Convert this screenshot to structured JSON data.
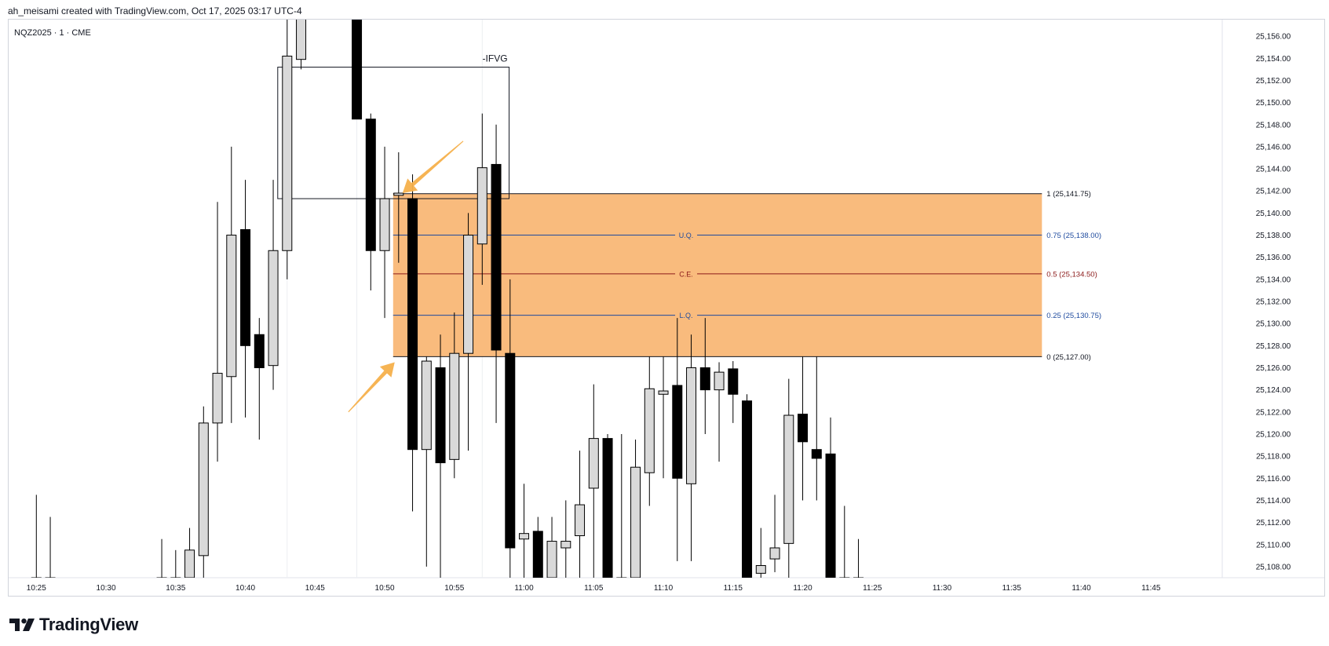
{
  "header": {
    "text": "ah_meisami created with TradingView.com, Oct 17, 2025 03:17 UTC-4"
  },
  "symbol": {
    "text": "NQZ2025 · 1 · CME"
  },
  "footer": {
    "brand": "TradingView"
  },
  "colors": {
    "up_body": "#d9d9d9",
    "down_body": "#000000",
    "wick": "#000000",
    "zone_fill": "#f9bb7d",
    "zone_line": "#131722",
    "level_blue": "#1e4a9e",
    "level_red": "#8b1a1a",
    "arrow": "#f5b04b"
  },
  "chart_data": {
    "type": "candlestick",
    "symbol": "NQZ2025",
    "interval": "1",
    "exchange": "CME",
    "ylim": [
      25107,
      25157.5
    ],
    "y_ticks": [
      "25,108.00",
      "25,110.00",
      "25,112.00",
      "25,114.00",
      "25,116.00",
      "25,118.00",
      "25,120.00",
      "25,122.00",
      "25,124.00",
      "25,126.00",
      "25,128.00",
      "25,130.00",
      "25,132.00",
      "25,134.00",
      "25,136.00",
      "25,138.00",
      "25,140.00",
      "25,142.00",
      "25,144.00",
      "25,146.00",
      "25,148.00",
      "25,150.00",
      "25,152.00",
      "25,154.00",
      "25,156.00"
    ],
    "x_ticks": [
      "10:25",
      "10:30",
      "10:35",
      "10:40",
      "10:45",
      "10:50",
      "10:55",
      "11:00",
      "11:05",
      "11:10",
      "11:15",
      "11:20",
      "11:25",
      "11:30",
      "11:35",
      "11:40",
      "11:45"
    ],
    "candles": [
      {
        "t": "10:25",
        "o": 25107,
        "h": 25114.5,
        "l": 25107,
        "c": 25107
      },
      {
        "t": "10:26",
        "o": 25107,
        "h": 25112.5,
        "l": 25107,
        "c": 25107
      },
      {
        "t": "10:34",
        "o": 25107,
        "h": 25110.5,
        "l": 25107,
        "c": 25107
      },
      {
        "t": "10:35",
        "o": 25107,
        "h": 25109.5,
        "l": 25107,
        "c": 25107
      },
      {
        "t": "10:36",
        "o": 25107,
        "h": 25111.5,
        "l": 25107,
        "c": 25109.5
      },
      {
        "t": "10:37",
        "o": 25109,
        "h": 25122.5,
        "l": 25107,
        "c": 25121
      },
      {
        "t": "10:38",
        "o": 25121,
        "h": 25141,
        "l": 25117.5,
        "c": 25125.5
      },
      {
        "t": "10:39",
        "o": 25125.2,
        "h": 25146,
        "l": 25121,
        "c": 25138
      },
      {
        "t": "10:40",
        "o": 25138.5,
        "h": 25143,
        "l": 25121.5,
        "c": 25128
      },
      {
        "t": "10:41",
        "o": 25129,
        "h": 25130.5,
        "l": 25119.5,
        "c": 25126
      },
      {
        "t": "10:42",
        "o": 25126.2,
        "h": 25143,
        "l": 25124,
        "c": 25136.6
      },
      {
        "t": "10:43",
        "o": 25136.6,
        "h": 25158,
        "l": 25134,
        "c": 25154.2
      },
      {
        "t": "10:44",
        "o": 25153.9,
        "h": 25158,
        "l": 25153,
        "c": 25158
      },
      {
        "t": "10:48",
        "o": 25158,
        "h": 25158,
        "l": 25148.5,
        "c": 25148.5
      },
      {
        "t": "10:49",
        "o": 25148.5,
        "h": 25149,
        "l": 25133,
        "c": 25136.6
      },
      {
        "t": "10:50",
        "o": 25136.6,
        "h": 25146,
        "l": 25130.5,
        "c": 25141.3
      },
      {
        "t": "10:51",
        "o": 25141.6,
        "h": 25145.5,
        "l": 25135.5,
        "c": 25141.8
      },
      {
        "t": "10:52",
        "o": 25141.3,
        "h": 25143.5,
        "l": 25113,
        "c": 25118.6
      },
      {
        "t": "10:53",
        "o": 25118.6,
        "h": 25127,
        "l": 25108,
        "c": 25126.6
      },
      {
        "t": "10:54",
        "o": 25126,
        "h": 25129,
        "l": 25107,
        "c": 25117.4
      },
      {
        "t": "10:55",
        "o": 25117.7,
        "h": 25131,
        "l": 25116,
        "c": 25127.3
      },
      {
        "t": "10:56",
        "o": 25127.3,
        "h": 25140,
        "l": 25118.5,
        "c": 25138
      },
      {
        "t": "10:57",
        "o": 25137.2,
        "h": 25149,
        "l": 25133.5,
        "c": 25144.1
      },
      {
        "t": "10:58",
        "o": 25144.4,
        "h": 25148,
        "l": 25121,
        "c": 25127.6
      },
      {
        "t": "10:59",
        "o": 25127.3,
        "h": 25134,
        "l": 25107,
        "c": 25109.7
      },
      {
        "t": "11:00",
        "o": 25110.5,
        "h": 25115.5,
        "l": 25107,
        "c": 25111
      },
      {
        "t": "11:01",
        "o": 25111.2,
        "h": 25112.5,
        "l": 25107,
        "c": 25107
      },
      {
        "t": "11:02",
        "o": 25107,
        "h": 25112.5,
        "l": 25107,
        "c": 25110.3
      },
      {
        "t": "11:03",
        "o": 25109.7,
        "h": 25114,
        "l": 25107,
        "c": 25110.3
      },
      {
        "t": "11:04",
        "o": 25110.8,
        "h": 25118.5,
        "l": 25107,
        "c": 25113.6
      },
      {
        "t": "11:05",
        "o": 25115.1,
        "h": 25124.5,
        "l": 25107,
        "c": 25119.6
      },
      {
        "t": "11:06",
        "o": 25119.6,
        "h": 25120,
        "l": 25107,
        "c": 25107
      },
      {
        "t": "11:07",
        "o": 25107,
        "h": 25120,
        "l": 25107,
        "c": 25107
      },
      {
        "t": "11:08",
        "o": 25107,
        "h": 25119.5,
        "l": 25107,
        "c": 25117
      },
      {
        "t": "11:09",
        "o": 25116.5,
        "h": 25127,
        "l": 25113.5,
        "c": 25124.1
      },
      {
        "t": "11:10",
        "o": 25123.6,
        "h": 25127,
        "l": 25116,
        "c": 25123.9
      },
      {
        "t": "11:11",
        "o": 25124.4,
        "h": 25130.5,
        "l": 25108.5,
        "c": 25116
      },
      {
        "t": "11:12",
        "o": 25115.5,
        "h": 25129,
        "l": 25108.5,
        "c": 25126
      },
      {
        "t": "11:13",
        "o": 25126,
        "h": 25130.5,
        "l": 25120,
        "c": 25124
      },
      {
        "t": "11:14",
        "o": 25124,
        "h": 25126.5,
        "l": 25117.5,
        "c": 25125.6
      },
      {
        "t": "11:15",
        "o": 25125.9,
        "h": 25126.6,
        "l": 25121,
        "c": 25123.6
      },
      {
        "t": "11:16",
        "o": 25123,
        "h": 25123.6,
        "l": 25107,
        "c": 25107
      },
      {
        "t": "11:17",
        "o": 25107.4,
        "h": 25111.5,
        "l": 25107,
        "c": 25108.1
      },
      {
        "t": "11:18",
        "o": 25108.7,
        "h": 25114.5,
        "l": 25107.5,
        "c": 25109.7
      },
      {
        "t": "11:19",
        "o": 25110.1,
        "h": 25125,
        "l": 25107,
        "c": 25121.7
      },
      {
        "t": "11:20",
        "o": 25121.8,
        "h": 25127,
        "l": 25114,
        "c": 25119.3
      },
      {
        "t": "11:21",
        "o": 25118.6,
        "h": 25127,
        "l": 25114,
        "c": 25117.8
      },
      {
        "t": "11:22",
        "o": 25118.2,
        "h": 25121.5,
        "l": 25107,
        "c": 25107
      },
      {
        "t": "11:23",
        "o": 25107,
        "h": 25113.5,
        "l": 25107,
        "c": 25107
      },
      {
        "t": "11:24",
        "o": 25107,
        "h": 25110.5,
        "l": 25107,
        "c": 25107
      }
    ],
    "ifvg_box": {
      "label": "-IFVG",
      "t_start": "10:43",
      "t_end": "11:00",
      "top": 25153.2,
      "bottom": 25141.3
    },
    "fib_zone": {
      "t_start": "10:51",
      "t_end": "11:37",
      "levels": [
        {
          "ratio": "1",
          "value": 25141.75,
          "label": "1 (25,141.75)",
          "mid_label": "",
          "color": "#131722"
        },
        {
          "ratio": "0.75",
          "value": 25138.0,
          "label": "0.75 (25,138.00)",
          "mid_label": "U.Q.",
          "color": "#1e4a9e"
        },
        {
          "ratio": "0.5",
          "value": 25134.5,
          "label": "0.5 (25,134.50)",
          "mid_label": "C.E.",
          "color": "#8b1a1a"
        },
        {
          "ratio": "0.25",
          "value": 25130.75,
          "label": "0.25 (25,130.75)",
          "mid_label": "L.Q.",
          "color": "#1e4a9e"
        },
        {
          "ratio": "0",
          "value": 25127.0,
          "label": "0 (25,127.00)",
          "mid_label": "",
          "color": "#131722"
        }
      ]
    },
    "arrows": [
      {
        "name": "arrow-upper",
        "from": [
          "10:58",
          25146.5
        ],
        "to": [
          "10:51",
          25141.8
        ]
      },
      {
        "name": "arrow-lower",
        "from": [
          "10:47",
          25122
        ],
        "to": [
          "10:51",
          25126.5
        ]
      }
    ]
  }
}
